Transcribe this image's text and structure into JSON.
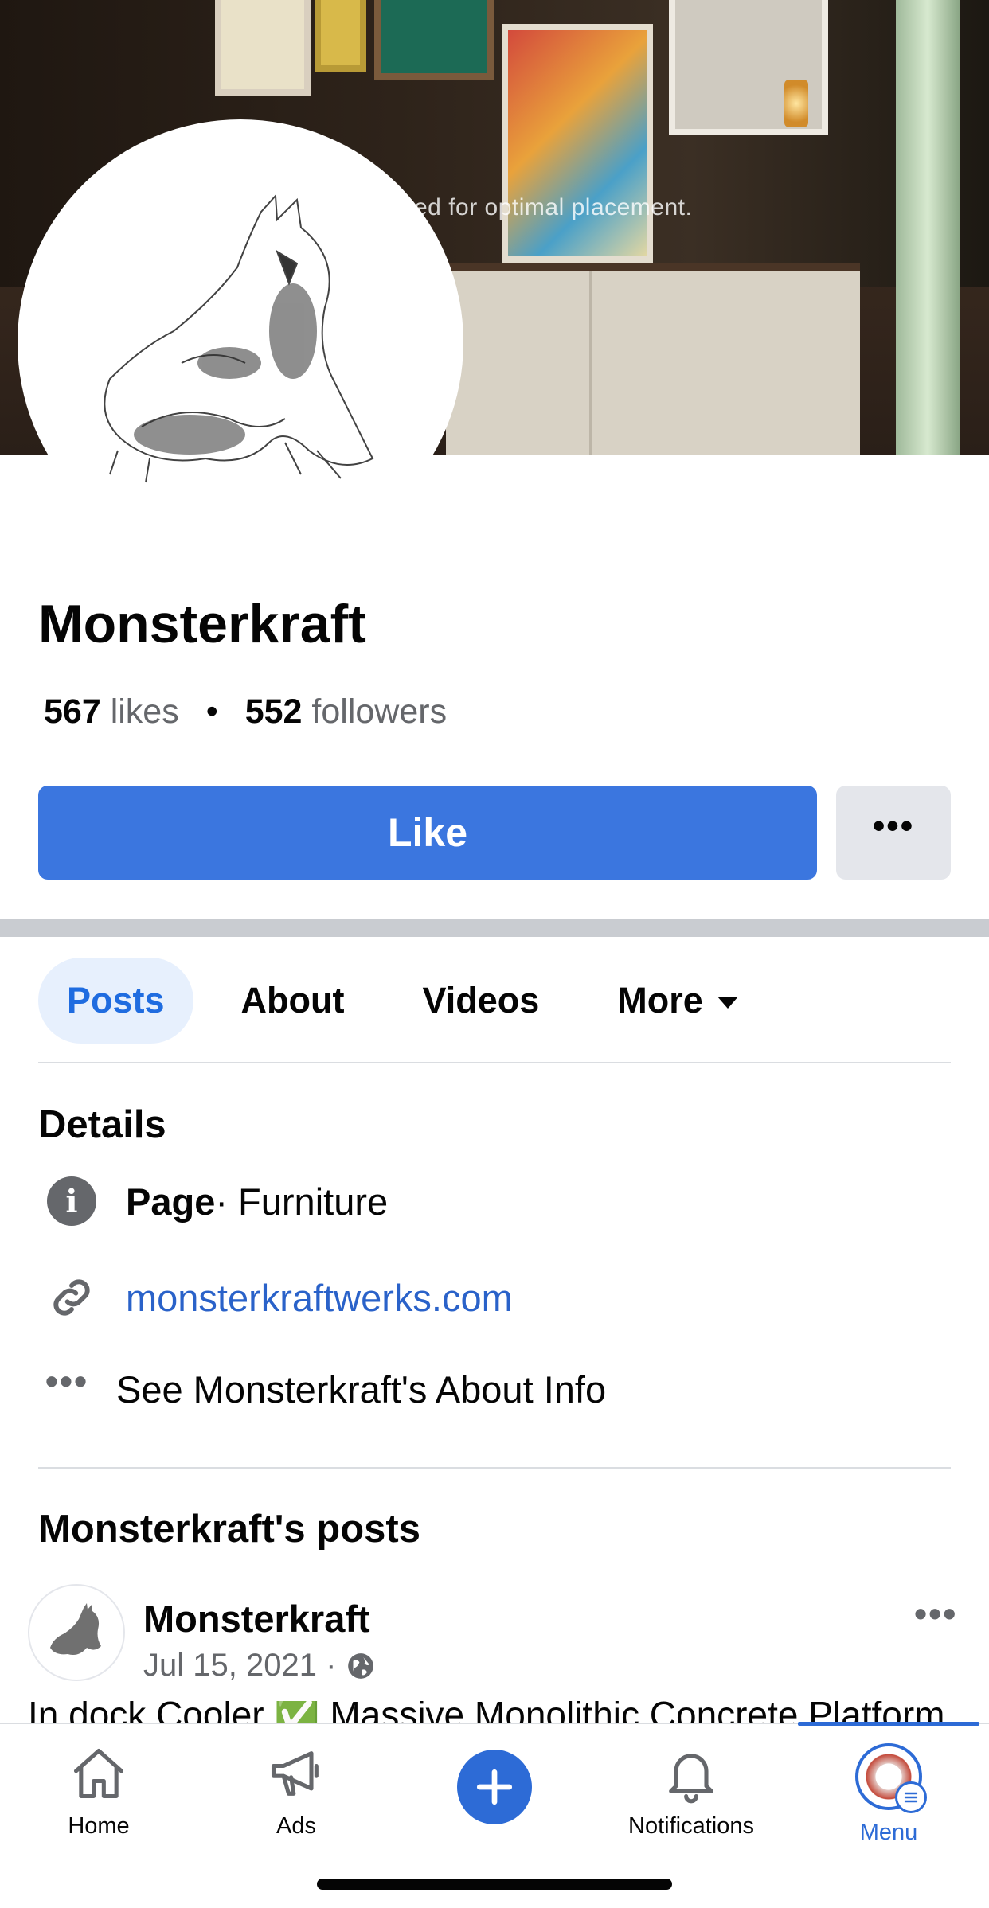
{
  "cover": {
    "caption": "ed for optimal placement."
  },
  "page": {
    "name": "Monsterkraft",
    "likes_count": "567",
    "likes_label": "likes",
    "followers_count": "552",
    "followers_label": "followers",
    "like_button": "Like",
    "more_button": "•••"
  },
  "tabs": [
    {
      "label": "Posts",
      "active": true
    },
    {
      "label": "About",
      "active": false
    },
    {
      "label": "Videos",
      "active": false
    },
    {
      "label": "More",
      "active": false
    }
  ],
  "details": {
    "title": "Details",
    "category_bold": "Page",
    "category_rest": " · Furniture",
    "website": "monsterkraftwerks.com",
    "about_info": "See Monsterkraft's About Info"
  },
  "posts": {
    "title": "Monsterkraft's posts",
    "items": [
      {
        "author": "Monsterkraft",
        "date": "Jul 15, 2021 ·",
        "menu": "•••",
        "text": "In dock Cooler ✅ Massive Monolithic Concrete Platform"
      }
    ]
  },
  "bottom_nav": {
    "items": [
      {
        "label": "Home",
        "icon": "home-icon"
      },
      {
        "label": "Ads",
        "icon": "megaphone-icon"
      },
      {
        "label": "",
        "icon": "plus-icon"
      },
      {
        "label": "Notifications",
        "icon": "bell-icon"
      },
      {
        "label": "Menu",
        "icon": "profile-avatar-icon",
        "active": true
      }
    ]
  },
  "colors": {
    "accent": "#3b76df",
    "link": "#2a62c9",
    "active_tab_bg": "#e7f0fd",
    "nav_active": "#2d6bd6"
  }
}
